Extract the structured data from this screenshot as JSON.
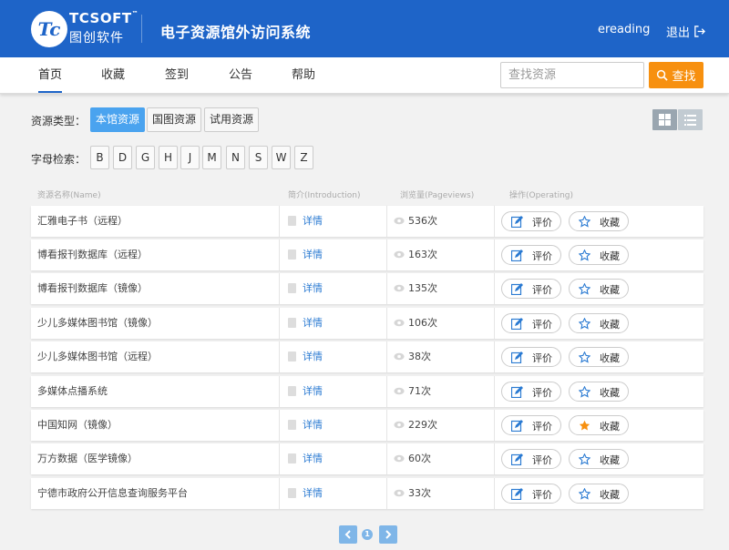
{
  "header": {
    "logo_text": "Tc",
    "brand_en": "TCSOFT",
    "brand_tm": "™",
    "brand_cn": "图创软件",
    "system_title": "电子资源馆外访问系统",
    "username": "ereading",
    "logout_label": "退出"
  },
  "nav": {
    "items": [
      "首页",
      "收藏",
      "签到",
      "公告",
      "帮助"
    ],
    "search_placeholder": "查找资源",
    "search_button": "查找"
  },
  "filters": {
    "type_label": "资源类型：",
    "types": [
      "本馆资源",
      "国图资源",
      "试用资源"
    ],
    "letter_label": "字母检索：",
    "letters": [
      "B",
      "D",
      "G",
      "H",
      "J",
      "M",
      "N",
      "S",
      "W",
      "Z"
    ]
  },
  "table": {
    "headers": [
      "资源名称(Name)",
      "简介(Introduction)",
      "浏览量(Pageviews)",
      "操作(Operating)"
    ],
    "detail_label": "详情",
    "rate_label": "评价",
    "fav_label": "收藏",
    "rows": [
      {
        "name": "汇雅电子书（远程）",
        "views": "536次",
        "favorited": false
      },
      {
        "name": "博看报刊数据库（远程）",
        "views": "163次",
        "favorited": false
      },
      {
        "name": "博看报刊数据库（镜像）",
        "views": "135次",
        "favorited": false
      },
      {
        "name": "少儿多媒体图书馆（镜像）",
        "views": "106次",
        "favorited": false
      },
      {
        "name": "少儿多媒体图书馆（远程）",
        "views": "38次",
        "favorited": false
      },
      {
        "name": "多媒体点播系统",
        "views": "71次",
        "favorited": false
      },
      {
        "name": "中国知网（镜像）",
        "views": "229次",
        "favorited": true
      },
      {
        "name": "万方数据（医学镜像）",
        "views": "60次",
        "favorited": false
      },
      {
        "name": "宁德市政府公开信息查询服务平台",
        "views": "33次",
        "favorited": false
      }
    ]
  },
  "pagination": {
    "current_page": "1"
  },
  "colors": {
    "header_bg": "#1e64c8",
    "accent_blue": "#4aa3ef",
    "search_orange": "#f7900f",
    "fav_star_active": "#f7900f",
    "link_blue": "#2a7ad2"
  }
}
